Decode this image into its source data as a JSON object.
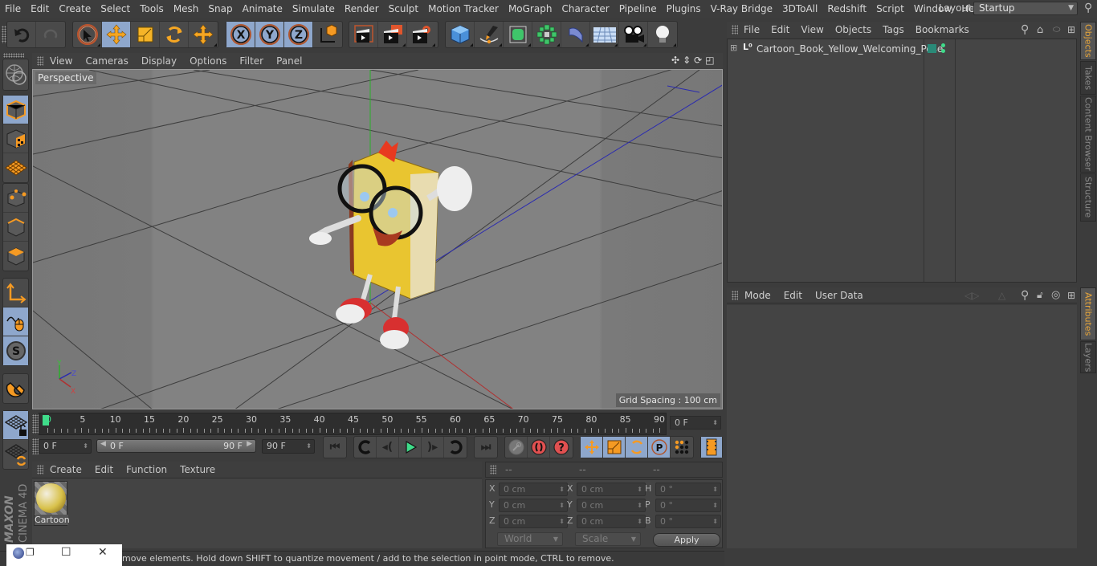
{
  "menubar": {
    "items": [
      "File",
      "Edit",
      "Create",
      "Select",
      "Tools",
      "Mesh",
      "Snap",
      "Animate",
      "Simulate",
      "Render",
      "Sculpt",
      "Motion Tracker",
      "MoGraph",
      "Character",
      "Pipeline",
      "Plugins",
      "V-Ray Bridge",
      "3DToAll",
      "Redshift",
      "Script",
      "Window",
      "Help"
    ],
    "layout_label": "Layout:",
    "layout_value": "Startup"
  },
  "toolbar": {
    "groups": [
      [
        "undo-icon",
        "redo-icon"
      ],
      [
        "live-selection-icon",
        "move-icon",
        "scale-icon",
        "rotate-icon",
        "recent-tools-icon"
      ],
      [
        "x-axis-lock-icon",
        "y-axis-lock-icon",
        "z-axis-lock-icon",
        "coordinate-system-icon"
      ],
      [
        "render-view-icon",
        "render-to-picture-viewer-icon",
        "render-settings-icon"
      ],
      [
        "cube-icon",
        "pen-spline-icon",
        "subdivision-surface-icon",
        "cloner-icon",
        "deformer-icon",
        "floor-icon",
        "camera-icon",
        "light-icon"
      ]
    ],
    "axis_labels": [
      "X",
      "Y",
      "Z"
    ]
  },
  "left_tools": [
    "make-editable-icon",
    "model-mode-icon",
    "texture-mode-icon",
    "workplane-mode-icon",
    "points-mode-icon",
    "edges-mode-icon",
    "polygons-mode-icon",
    "axis-mode-icon",
    "tweak-mode-icon",
    "solo-mode-icon",
    "snap-icon",
    "workplane-lock-icon",
    "workplane-align-icon"
  ],
  "viewport": {
    "menu": [
      "View",
      "Cameras",
      "Display",
      "Options",
      "Filter",
      "Panel"
    ],
    "label": "Perspective",
    "grid_spacing": "Grid Spacing : 100 cm",
    "axis_letters": [
      "Y",
      "Z",
      "X"
    ]
  },
  "timeline": {
    "ticks": [
      "0",
      "5",
      "10",
      "15",
      "20",
      "25",
      "30",
      "35",
      "40",
      "45",
      "50",
      "55",
      "60",
      "65",
      "70",
      "75",
      "80",
      "85",
      "90"
    ],
    "current_frame": 0,
    "end_field": "0 F",
    "start_field": "0 F",
    "range_start": "0 F",
    "range_end": "90 F",
    "max_field": "90 F"
  },
  "playback": {
    "buttons": [
      "go-to-start-icon",
      "previous-keyframe-icon",
      "previous-frame-icon",
      "play-icon",
      "next-frame-icon",
      "next-keyframe-icon",
      "go-to-end-icon"
    ],
    "record_buttons": [
      "record-active-objects-icon",
      "autokeying-icon",
      "keyframe-selection-icon"
    ],
    "key_buttons": [
      "key-position-icon",
      "key-scale-icon",
      "key-rotation-icon",
      "key-parameter-icon",
      "key-point-level-icon"
    ],
    "timeline_button": "timeline-icon"
  },
  "material_manager": {
    "menu": [
      "Create",
      "Edit",
      "Function",
      "Texture"
    ],
    "materials": [
      {
        "name": "Cartoon"
      }
    ]
  },
  "coordinates": {
    "headers": [
      "--",
      "--",
      "--"
    ],
    "rows": [
      {
        "l1": "X",
        "v1": "0 cm",
        "l2": "X",
        "v2": "0 cm",
        "l3": "H",
        "v3": "0 °"
      },
      {
        "l1": "Y",
        "v1": "0 cm",
        "l2": "Y",
        "v2": "0 cm",
        "l3": "P",
        "v3": "0 °"
      },
      {
        "l1": "Z",
        "v1": "0 cm",
        "l2": "Z",
        "v2": "0 cm",
        "l3": "B",
        "v3": "0 °"
      }
    ],
    "space": "World",
    "mode": "Scale",
    "apply": "Apply"
  },
  "status": {
    "text": "move elements. Hold down SHIFT to quantize movement / add to the selection in point mode, CTRL to remove."
  },
  "object_manager": {
    "menu": [
      "File",
      "Edit",
      "View",
      "Objects",
      "Tags",
      "Bookmarks"
    ],
    "objects": [
      {
        "name": "Cartoon_Book_Yellow_Welcoming_Pose",
        "tag_color": "#2a8a78"
      }
    ]
  },
  "attribute_manager": {
    "menu": [
      "Mode",
      "Edit",
      "User Data"
    ]
  },
  "right_tabs_top": [
    "Objects",
    "Takes",
    "Content Browser",
    "Structure"
  ],
  "right_tabs_bottom": [
    "Attributes",
    "Layers"
  ],
  "branding": {
    "maxon": "MAXON",
    "product": "CINEMA 4D"
  },
  "colors": {
    "accent_active": "#8ea7cc",
    "tab_active_text": "#e8a63a",
    "playhead": "#3fdc8a"
  }
}
